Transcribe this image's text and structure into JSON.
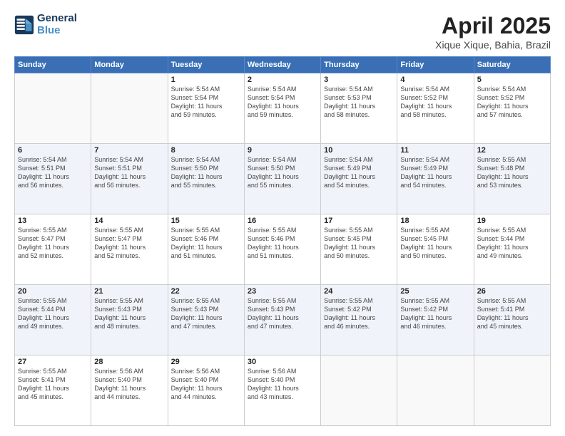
{
  "logo": {
    "line1": "General",
    "line2": "Blue"
  },
  "title": "April 2025",
  "subtitle": "Xique Xique, Bahia, Brazil",
  "headers": [
    "Sunday",
    "Monday",
    "Tuesday",
    "Wednesday",
    "Thursday",
    "Friday",
    "Saturday"
  ],
  "weeks": [
    [
      {
        "day": "",
        "info": ""
      },
      {
        "day": "",
        "info": ""
      },
      {
        "day": "1",
        "info": "Sunrise: 5:54 AM\nSunset: 5:54 PM\nDaylight: 11 hours\nand 59 minutes."
      },
      {
        "day": "2",
        "info": "Sunrise: 5:54 AM\nSunset: 5:54 PM\nDaylight: 11 hours\nand 59 minutes."
      },
      {
        "day": "3",
        "info": "Sunrise: 5:54 AM\nSunset: 5:53 PM\nDaylight: 11 hours\nand 58 minutes."
      },
      {
        "day": "4",
        "info": "Sunrise: 5:54 AM\nSunset: 5:52 PM\nDaylight: 11 hours\nand 58 minutes."
      },
      {
        "day": "5",
        "info": "Sunrise: 5:54 AM\nSunset: 5:52 PM\nDaylight: 11 hours\nand 57 minutes."
      }
    ],
    [
      {
        "day": "6",
        "info": "Sunrise: 5:54 AM\nSunset: 5:51 PM\nDaylight: 11 hours\nand 56 minutes."
      },
      {
        "day": "7",
        "info": "Sunrise: 5:54 AM\nSunset: 5:51 PM\nDaylight: 11 hours\nand 56 minutes."
      },
      {
        "day": "8",
        "info": "Sunrise: 5:54 AM\nSunset: 5:50 PM\nDaylight: 11 hours\nand 55 minutes."
      },
      {
        "day": "9",
        "info": "Sunrise: 5:54 AM\nSunset: 5:50 PM\nDaylight: 11 hours\nand 55 minutes."
      },
      {
        "day": "10",
        "info": "Sunrise: 5:54 AM\nSunset: 5:49 PM\nDaylight: 11 hours\nand 54 minutes."
      },
      {
        "day": "11",
        "info": "Sunrise: 5:54 AM\nSunset: 5:49 PM\nDaylight: 11 hours\nand 54 minutes."
      },
      {
        "day": "12",
        "info": "Sunrise: 5:55 AM\nSunset: 5:48 PM\nDaylight: 11 hours\nand 53 minutes."
      }
    ],
    [
      {
        "day": "13",
        "info": "Sunrise: 5:55 AM\nSunset: 5:47 PM\nDaylight: 11 hours\nand 52 minutes."
      },
      {
        "day": "14",
        "info": "Sunrise: 5:55 AM\nSunset: 5:47 PM\nDaylight: 11 hours\nand 52 minutes."
      },
      {
        "day": "15",
        "info": "Sunrise: 5:55 AM\nSunset: 5:46 PM\nDaylight: 11 hours\nand 51 minutes."
      },
      {
        "day": "16",
        "info": "Sunrise: 5:55 AM\nSunset: 5:46 PM\nDaylight: 11 hours\nand 51 minutes."
      },
      {
        "day": "17",
        "info": "Sunrise: 5:55 AM\nSunset: 5:45 PM\nDaylight: 11 hours\nand 50 minutes."
      },
      {
        "day": "18",
        "info": "Sunrise: 5:55 AM\nSunset: 5:45 PM\nDaylight: 11 hours\nand 50 minutes."
      },
      {
        "day": "19",
        "info": "Sunrise: 5:55 AM\nSunset: 5:44 PM\nDaylight: 11 hours\nand 49 minutes."
      }
    ],
    [
      {
        "day": "20",
        "info": "Sunrise: 5:55 AM\nSunset: 5:44 PM\nDaylight: 11 hours\nand 49 minutes."
      },
      {
        "day": "21",
        "info": "Sunrise: 5:55 AM\nSunset: 5:43 PM\nDaylight: 11 hours\nand 48 minutes."
      },
      {
        "day": "22",
        "info": "Sunrise: 5:55 AM\nSunset: 5:43 PM\nDaylight: 11 hours\nand 47 minutes."
      },
      {
        "day": "23",
        "info": "Sunrise: 5:55 AM\nSunset: 5:43 PM\nDaylight: 11 hours\nand 47 minutes."
      },
      {
        "day": "24",
        "info": "Sunrise: 5:55 AM\nSunset: 5:42 PM\nDaylight: 11 hours\nand 46 minutes."
      },
      {
        "day": "25",
        "info": "Sunrise: 5:55 AM\nSunset: 5:42 PM\nDaylight: 11 hours\nand 46 minutes."
      },
      {
        "day": "26",
        "info": "Sunrise: 5:55 AM\nSunset: 5:41 PM\nDaylight: 11 hours\nand 45 minutes."
      }
    ],
    [
      {
        "day": "27",
        "info": "Sunrise: 5:55 AM\nSunset: 5:41 PM\nDaylight: 11 hours\nand 45 minutes."
      },
      {
        "day": "28",
        "info": "Sunrise: 5:56 AM\nSunset: 5:40 PM\nDaylight: 11 hours\nand 44 minutes."
      },
      {
        "day": "29",
        "info": "Sunrise: 5:56 AM\nSunset: 5:40 PM\nDaylight: 11 hours\nand 44 minutes."
      },
      {
        "day": "30",
        "info": "Sunrise: 5:56 AM\nSunset: 5:40 PM\nDaylight: 11 hours\nand 43 minutes."
      },
      {
        "day": "",
        "info": ""
      },
      {
        "day": "",
        "info": ""
      },
      {
        "day": "",
        "info": ""
      }
    ]
  ]
}
